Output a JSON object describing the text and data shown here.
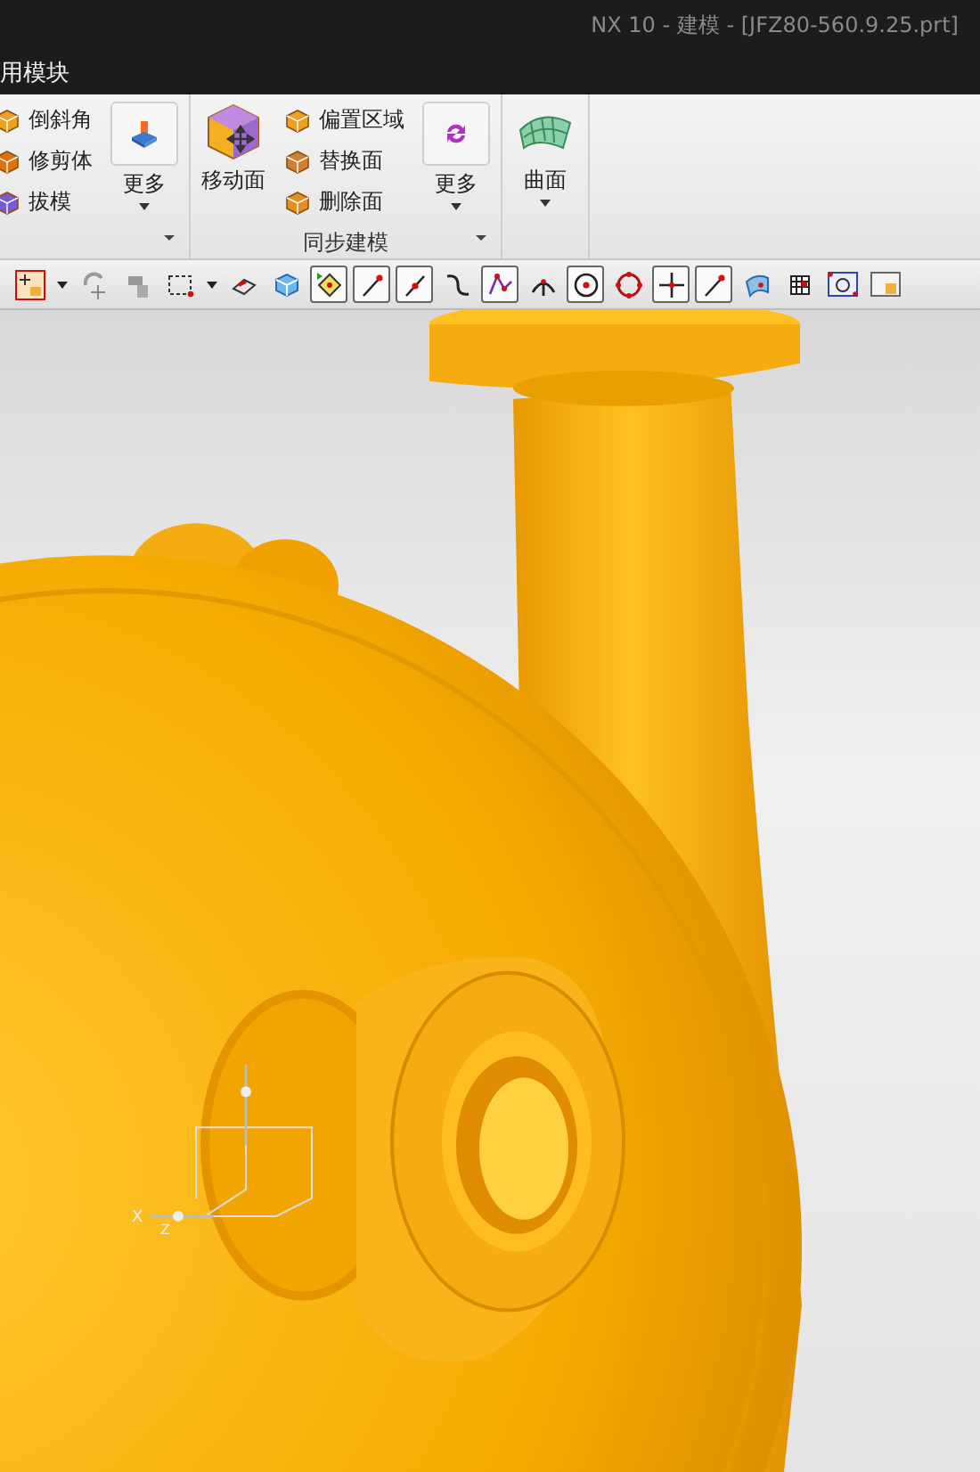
{
  "window": {
    "title": "NX 10 - 建模 - [JFZ80-560.9.25.prt]"
  },
  "menu": {
    "label": "用模块"
  },
  "ribbon": {
    "groups": [
      {
        "items": [
          {
            "kind": "stack",
            "entries": [
              {
                "label": "倒斜角"
              },
              {
                "label": "修剪体"
              },
              {
                "label": "拔模"
              }
            ]
          },
          {
            "kind": "large",
            "label": "更多",
            "dropdown": true
          }
        ]
      },
      {
        "title": "同步建模",
        "items": [
          {
            "kind": "large",
            "label": "移动面",
            "dropdown": false
          },
          {
            "kind": "stack",
            "entries": [
              {
                "label": "偏置区域"
              },
              {
                "label": "替换面"
              },
              {
                "label": "删除面"
              }
            ]
          },
          {
            "kind": "large",
            "label": "更多",
            "dropdown": true
          }
        ]
      },
      {
        "items": [
          {
            "kind": "large",
            "label": "曲面",
            "dropdown": true
          }
        ]
      }
    ]
  },
  "toolbar": {
    "tools": [
      {
        "kind": "snap",
        "selected": false
      },
      {
        "kind": "caret",
        "selected": false
      },
      {
        "kind": "rotate",
        "selected": false
      },
      {
        "kind": "layers",
        "selected": false
      },
      {
        "kind": "box-select",
        "selected": false
      },
      {
        "kind": "caret",
        "selected": false
      },
      {
        "kind": "eraser",
        "selected": false
      },
      {
        "kind": "cube",
        "selected": false
      },
      {
        "kind": "points",
        "selected": true
      },
      {
        "kind": "line-end",
        "selected": true
      },
      {
        "kind": "line-mid",
        "selected": true
      },
      {
        "kind": "curve",
        "selected": false
      },
      {
        "kind": "polyline",
        "selected": true
      },
      {
        "kind": "intersect",
        "selected": false
      },
      {
        "kind": "circle-center",
        "selected": true
      },
      {
        "kind": "circle-points",
        "selected": false
      },
      {
        "kind": "cross",
        "selected": true
      },
      {
        "kind": "line-end",
        "selected": true
      },
      {
        "kind": "surface",
        "selected": false
      },
      {
        "kind": "mesh",
        "selected": false
      },
      {
        "kind": "view-fit",
        "selected": false
      },
      {
        "kind": "view-image",
        "selected": false
      }
    ]
  },
  "viewport": {
    "triad": {
      "x_label": "X",
      "z_label": "Z"
    }
  }
}
